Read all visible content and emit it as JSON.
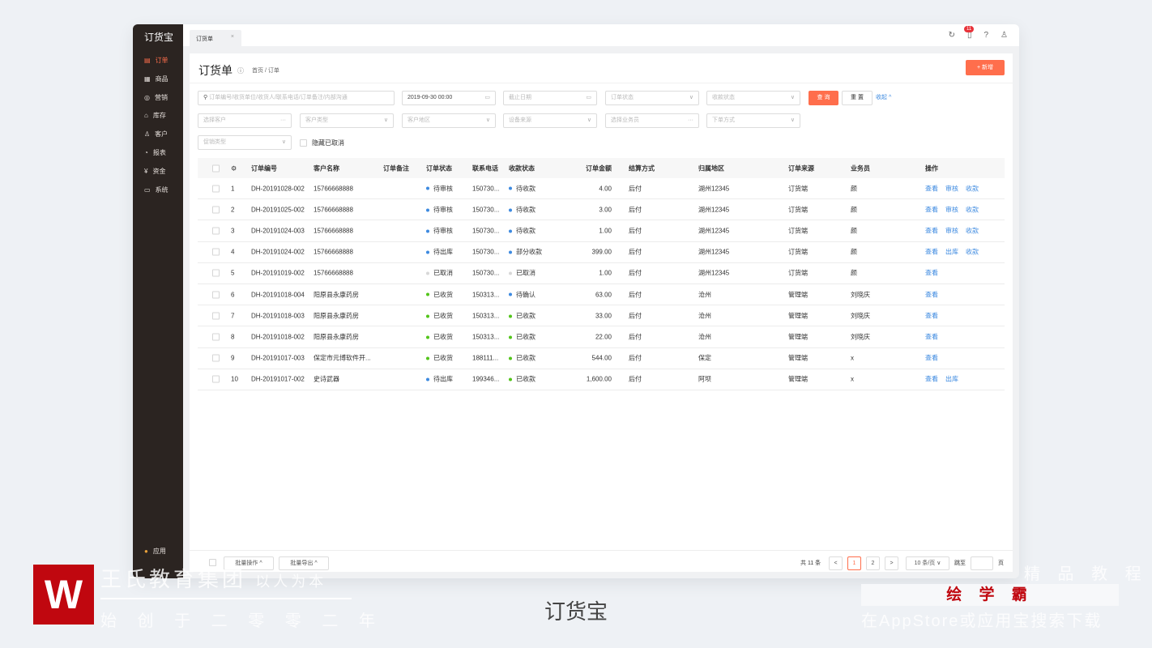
{
  "app": {
    "logo": "订货宝",
    "tab": "订货单",
    "badge_count": "11"
  },
  "sidebar": {
    "items": [
      {
        "label": "订单",
        "icon": "order-icon",
        "active": true
      },
      {
        "label": "商品",
        "icon": "grid-icon"
      },
      {
        "label": "营销",
        "icon": "marketing-icon"
      },
      {
        "label": "库存",
        "icon": "warehouse-icon"
      },
      {
        "label": "客户",
        "icon": "user-icon"
      },
      {
        "label": "报表",
        "icon": "pie-chart-icon"
      },
      {
        "label": "资金",
        "icon": "money-icon"
      },
      {
        "label": "系统",
        "icon": "monitor-icon"
      }
    ],
    "bottom": "应用"
  },
  "page": {
    "title": "订货单",
    "breadcrumb": "首页 / 订单",
    "new_label": "+ 新增"
  },
  "filters": {
    "search_placeholder": "订单编号/收货单位/收货人/联系电话/订单备注/内部沟通",
    "start_date": "2019-09-30 00:00",
    "end_placeholder": "截止日期",
    "order_status": "订单状态",
    "pay_status": "收款状态",
    "query": "查 询",
    "reset": "重 置",
    "collapse": "收起 ^",
    "customer": "选择客户",
    "customer_type": "客户类型",
    "region": "客户地区",
    "device": "设备来源",
    "salesman": "选择业务员",
    "order_method": "下单方式",
    "promo_type": "促销类型",
    "hide_cancelled": "隐藏已取消"
  },
  "table": {
    "headers": [
      "订单编号",
      "客户名称",
      "订单备注",
      "订单状态",
      "联系电话",
      "收款状态",
      "订单金额",
      "结算方式",
      "归属地区",
      "订单来源",
      "业务员",
      "操作"
    ],
    "rows": [
      {
        "idx": "1",
        "no": "DH-20191028-002",
        "cust": "15766668888",
        "status": "待审核",
        "sc": "#3d8ae0",
        "phone": "150730...",
        "pay": "待收款",
        "pc": "#3d8ae0",
        "amt": "4.00",
        "settle": "后付",
        "region": "湖州12345",
        "src": "订货端",
        "sales": "颜",
        "ops": [
          "查看",
          "审核",
          "收款"
        ]
      },
      {
        "idx": "2",
        "no": "DH-20191025-002",
        "cust": "15766668888",
        "status": "待审核",
        "sc": "#3d8ae0",
        "phone": "150730...",
        "pay": "待收款",
        "pc": "#3d8ae0",
        "amt": "3.00",
        "settle": "后付",
        "region": "湖州12345",
        "src": "订货端",
        "sales": "颜",
        "ops": [
          "查看",
          "审核",
          "收款"
        ]
      },
      {
        "idx": "3",
        "no": "DH-20191024-003",
        "cust": "15766668888",
        "status": "待审核",
        "sc": "#3d8ae0",
        "phone": "150730...",
        "pay": "待收款",
        "pc": "#3d8ae0",
        "amt": "1.00",
        "settle": "后付",
        "region": "湖州12345",
        "src": "订货端",
        "sales": "颜",
        "ops": [
          "查看",
          "审核",
          "收款"
        ]
      },
      {
        "idx": "4",
        "no": "DH-20191024-002",
        "cust": "15766668888",
        "status": "待出库",
        "sc": "#3d8ae0",
        "phone": "150730...",
        "pay": "部分收款",
        "pc": "#3d8ae0",
        "amt": "399.00",
        "settle": "后付",
        "region": "湖州12345",
        "src": "订货端",
        "sales": "颜",
        "ops": [
          "查看",
          "出库",
          "收款"
        ]
      },
      {
        "idx": "5",
        "no": "DH-20191019-002",
        "cust": "15766668888",
        "status": "已取消",
        "sc": "#d8d8d8",
        "phone": "150730...",
        "pay": "已取消",
        "pc": "#d8d8d8",
        "amt": "1.00",
        "settle": "后付",
        "region": "湖州12345",
        "src": "订货端",
        "sales": "颜",
        "ops": [
          "查看"
        ]
      },
      {
        "idx": "6",
        "no": "DH-20191018-004",
        "cust": "阳原县永康药房",
        "status": "已收货",
        "sc": "#52c41a",
        "phone": "150313...",
        "pay": "待确认",
        "pc": "#3d8ae0",
        "amt": "63.00",
        "settle": "后付",
        "region": "沧州",
        "src": "管理端",
        "sales": "刘晓庆",
        "ops": [
          "查看"
        ]
      },
      {
        "idx": "7",
        "no": "DH-20191018-003",
        "cust": "阳原县永康药房",
        "status": "已收货",
        "sc": "#52c41a",
        "phone": "150313...",
        "pay": "已收款",
        "pc": "#52c41a",
        "amt": "33.00",
        "settle": "后付",
        "region": "沧州",
        "src": "管理端",
        "sales": "刘晓庆",
        "ops": [
          "查看"
        ]
      },
      {
        "idx": "8",
        "no": "DH-20191018-002",
        "cust": "阳原县永康药房",
        "status": "已收货",
        "sc": "#52c41a",
        "phone": "150313...",
        "pay": "已收款",
        "pc": "#52c41a",
        "amt": "22.00",
        "settle": "后付",
        "region": "沧州",
        "src": "管理端",
        "sales": "刘晓庆",
        "ops": [
          "查看"
        ]
      },
      {
        "idx": "9",
        "no": "DH-20191017-003",
        "cust": "保定市元博软件开...",
        "status": "已收货",
        "sc": "#52c41a",
        "phone": "188111...",
        "pay": "已收款",
        "pc": "#52c41a",
        "amt": "544.00",
        "settle": "后付",
        "region": "保定",
        "src": "管理端",
        "sales": "x",
        "ops": [
          "查看"
        ]
      },
      {
        "idx": "10",
        "no": "DH-20191017-002",
        "cust": "史诗武器",
        "status": "待出库",
        "sc": "#3d8ae0",
        "phone": "199346...",
        "pay": "已收款",
        "pc": "#52c41a",
        "amt": "1,600.00",
        "settle": "后付",
        "region": "阿坝",
        "src": "管理端",
        "sales": "x",
        "ops": [
          "查看",
          "出库"
        ]
      }
    ]
  },
  "footer": {
    "batch_op": "批量操作 ^",
    "batch_export": "批量导出 ^",
    "total": "共 11 条",
    "pages": [
      "1",
      "2"
    ],
    "current_page": "1",
    "page_size": "10 条/页",
    "jump": "跳至",
    "page_unit": "页"
  },
  "caption": "订货宝",
  "watermark": {
    "brand": "王氏教育集团",
    "slogan": "以人为本",
    "since": "始 创 于 二 零 零 二 年",
    "right_top": "精 品 教 程",
    "right_brand": "绘 学 霸",
    "right_bottom": "在AppStore或应用宝搜索下载"
  },
  "colors": {
    "accent": "#ff6e4c",
    "link": "#3d8ae0",
    "sidebar": "#2b2421"
  }
}
